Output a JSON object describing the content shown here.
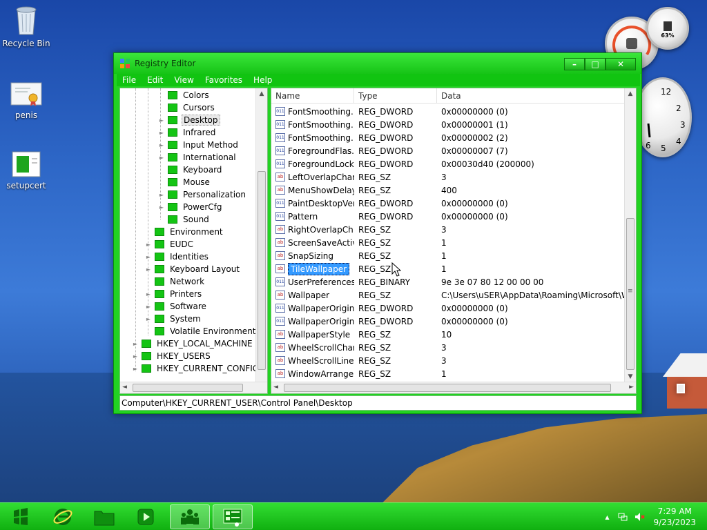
{
  "desktop": {
    "icons": [
      {
        "label": "Recycle Bin",
        "icon": "recycle-bin-icon"
      },
      {
        "label": "penis",
        "icon": "certificate-icon"
      },
      {
        "label": "setupcert",
        "icon": "setup-icon"
      }
    ],
    "gadget_cpu_percent": "63%"
  },
  "window": {
    "title": "Registry Editor",
    "controls": {
      "minimize": "–",
      "maximize": "□",
      "close": "✕"
    },
    "menu": [
      "File",
      "Edit",
      "View",
      "Favorites",
      "Help"
    ],
    "tree": [
      "Colors",
      "Cursors",
      "Desktop",
      "Infrared",
      "Input Method",
      "International",
      "Keyboard",
      "Mouse",
      "Personalization",
      "PowerCfg",
      "Sound",
      "Environment",
      "EUDC",
      "Identities",
      "Keyboard Layout",
      "Network",
      "Printers",
      "Software",
      "System",
      "Volatile Environment",
      "HKEY_LOCAL_MACHINE",
      "HKEY_USERS",
      "HKEY_CURRENT_CONFIG"
    ],
    "columns": {
      "name": "Name",
      "type": "Type",
      "data": "Data"
    },
    "rows": [
      {
        "name": "FontSmoothing...",
        "type": "REG_DWORD",
        "data": "0x00000000 (0)",
        "kind": "bin"
      },
      {
        "name": "FontSmoothing...",
        "type": "REG_DWORD",
        "data": "0x00000001 (1)",
        "kind": "bin"
      },
      {
        "name": "FontSmoothing...",
        "type": "REG_DWORD",
        "data": "0x00000002 (2)",
        "kind": "bin"
      },
      {
        "name": "ForegroundFlas...",
        "type": "REG_DWORD",
        "data": "0x00000007 (7)",
        "kind": "bin"
      },
      {
        "name": "ForegroundLock...",
        "type": "REG_DWORD",
        "data": "0x00030d40 (200000)",
        "kind": "bin"
      },
      {
        "name": "LeftOverlapChars",
        "type": "REG_SZ",
        "data": "3",
        "kind": "str"
      },
      {
        "name": "MenuShowDelay",
        "type": "REG_SZ",
        "data": "400",
        "kind": "str"
      },
      {
        "name": "PaintDesktopVer...",
        "type": "REG_DWORD",
        "data": "0x00000000 (0)",
        "kind": "bin"
      },
      {
        "name": "Pattern",
        "type": "REG_DWORD",
        "data": "0x00000000 (0)",
        "kind": "bin"
      },
      {
        "name": "RightOverlapCh...",
        "type": "REG_SZ",
        "data": "3",
        "kind": "str"
      },
      {
        "name": "ScreenSaveActive",
        "type": "REG_SZ",
        "data": "1",
        "kind": "str"
      },
      {
        "name": "SnapSizing",
        "type": "REG_SZ",
        "data": "1",
        "kind": "str"
      },
      {
        "name": "TileWallpaper",
        "type": "REG_SZ",
        "data": "1",
        "kind": "str"
      },
      {
        "name": "UserPreferences...",
        "type": "REG_BINARY",
        "data": "9e 3e 07 80 12 00 00 00",
        "kind": "bin"
      },
      {
        "name": "Wallpaper",
        "type": "REG_SZ",
        "data": "C:\\Users\\uSER\\AppData\\Roaming\\Microsoft\\Win...",
        "kind": "str"
      },
      {
        "name": "WallpaperOriginX",
        "type": "REG_DWORD",
        "data": "0x00000000 (0)",
        "kind": "bin"
      },
      {
        "name": "WallpaperOriginY",
        "type": "REG_DWORD",
        "data": "0x00000000 (0)",
        "kind": "bin"
      },
      {
        "name": "WallpaperStyle",
        "type": "REG_SZ",
        "data": "10",
        "kind": "str"
      },
      {
        "name": "WheelScrollChars",
        "type": "REG_SZ",
        "data": "3",
        "kind": "str"
      },
      {
        "name": "WheelScrollLines",
        "type": "REG_SZ",
        "data": "3",
        "kind": "str"
      },
      {
        "name": "WindowArrange...",
        "type": "REG_SZ",
        "data": "1",
        "kind": "str"
      }
    ],
    "selected_row": "TileWallpaper",
    "status": "Computer\\HKEY_CURRENT_USER\\Control Panel\\Desktop",
    "scroll_glyphs": {
      "up": "▲",
      "down": "▼",
      "left": "◄",
      "right": "►",
      "grip": "≡"
    }
  },
  "taskbar": {
    "items": [
      "start-orb-icon",
      "internet-explorer-icon",
      "explorer-folder-icon",
      "media-player-icon",
      "network-people-icon",
      "registry-editor-icon"
    ],
    "tray_up": "▲",
    "time": "7:29 AM",
    "date": "9/23/2023"
  },
  "colors": {
    "accent": "#22d222",
    "selection": "#3399ff"
  }
}
